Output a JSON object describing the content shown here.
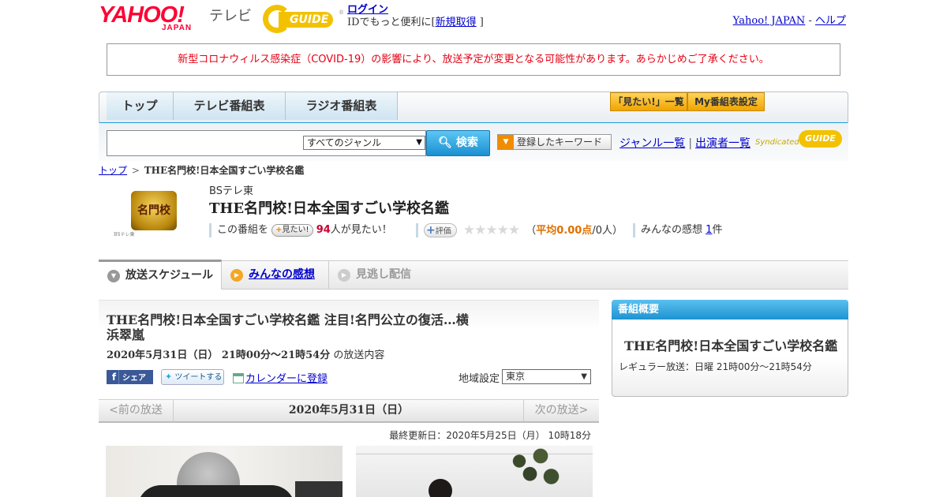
{
  "header": {
    "yahoo_logo": "YAHOO!",
    "yahoo_sub": "JAPAN",
    "tv_label": "テレビ",
    "gguide_logo": "GUIDE",
    "login": "ログイン",
    "id_text_pre": "IDでもっと便利に[",
    "register": "新規取得",
    "id_text_post": "]",
    "yahoo_japan_link": "Yahoo! JAPAN",
    "link_sep": "-",
    "help_link": "ヘルプ"
  },
  "notice": "新型コロナウィルス感染症（COVID-19）の影響により、放送予定が変更となる可能性があります。あらかじめご了承ください。",
  "nav": {
    "tabs": [
      {
        "label": "トップ"
      },
      {
        "label": "テレビ番組表"
      },
      {
        "label": "ラジオ番組表"
      }
    ],
    "mitai_list": "「見たい!」一覧",
    "my_schedule": "My番組表設定"
  },
  "search": {
    "query": "",
    "genre_selected": "すべてのジャンル",
    "search_button": "検索",
    "keyword_button": "登録したキーワード",
    "genre_list": "ジャンル一覧",
    "cast_list": "出演者一覧",
    "syndicated": "Syndicated",
    "syndicated_logo": "GUIDE"
  },
  "breadcrumb": {
    "top": "トップ",
    "sep": ">",
    "current": "THE名門校!日本全国すごい学校名鑑"
  },
  "program": {
    "logo_text": "名門校",
    "logo_small": "BSテレ東",
    "channel": "BSテレ東",
    "title": "THE名門校!日本全国すごい学校名鑑",
    "mitai_pre": "この番組を",
    "mitai_button": "見たい!",
    "mitai_count": "94",
    "mitai_post": "人が見たい！",
    "rate_button": "評価",
    "stars": "★★★★★",
    "rating_open": "（",
    "rating_avg": "平均0.00点",
    "rating_people": "/0人）",
    "reviews_pre": "みんなの感想",
    "reviews_count": "1",
    "reviews_post": "件"
  },
  "subtabs": [
    {
      "label": "放送スケジュール"
    },
    {
      "label": "みんなの感想"
    },
    {
      "label": "見逃し配信"
    }
  ],
  "broadcast": {
    "title": "THE名門校!日本全国すごい学校名鑑 注目!名門公立の復活…横浜翠嵐",
    "date_time": "2020年5月31日（日） 21時00分～21時54分",
    "date_suffix": "の放送内容",
    "fb_share": "シェア",
    "tweet": "ツイートする",
    "calendar": "カレンダーに登録",
    "region_label": "地域設定",
    "region_value": "東京",
    "prev": "<前の放送",
    "current_date": "2020年5月31日（日）",
    "next": "次の放送>",
    "updated": "最終更新日：2020年5月25日（月） 10時18分"
  },
  "summary": {
    "heading": "番組概要",
    "title": "THE名門校!日本全国すごい学校名鑑",
    "regular": "レギュラー放送：日曜 21時00分～21時54分"
  },
  "colors": {
    "yahoo_red": "#ff0033",
    "notice_red": "#e60012",
    "nav_blue": "#1a9ad8",
    "gguide_yellow": "#f2c200"
  }
}
